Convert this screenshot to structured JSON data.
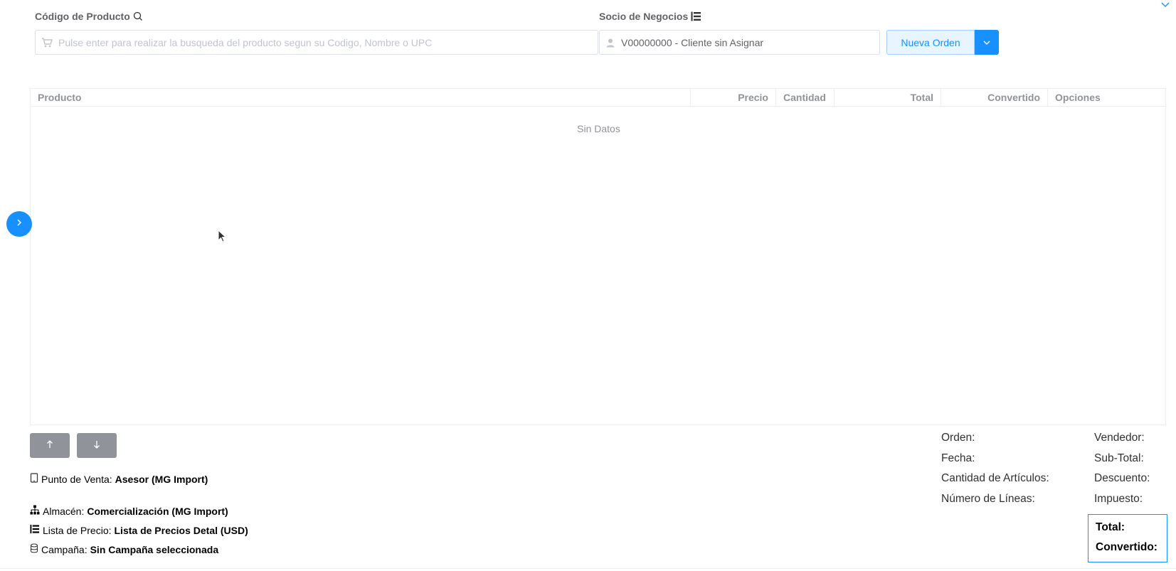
{
  "header": {
    "product_label": "Código de Producto",
    "partner_label": "Socio de Negocios",
    "product_search_placeholder": "Pulse enter para realizar la busqueda del producto segun su Codigo, Nombre o UPC",
    "partner_value": "V00000000 - Cliente sin Asignar",
    "new_order_label": "Nueva Orden"
  },
  "table": {
    "columns": {
      "producto": "Producto",
      "precio": "Precio",
      "cantidad": "Cantidad",
      "total": "Total",
      "convertido": "Convertido",
      "opciones": "Opciones"
    },
    "empty_text": "Sin Datos"
  },
  "info": {
    "pos_label": "Punto de Venta:",
    "pos_value": "Asesor (MG Import)",
    "warehouse_label": "Almacén:",
    "warehouse_value": "Comercialización (MG Import)",
    "pricelist_label": "Lista de Precio:",
    "pricelist_value": "Lista de Precios Detal (USD)",
    "campaign_label": "Campaña:",
    "campaign_value": "Sin Campaña seleccionada"
  },
  "summary": {
    "orden": "Orden:",
    "fecha": "Fecha:",
    "cantidad_articulos": "Cantidad de Artículos:",
    "numero_lineas": "Número de Líneas:",
    "vendedor": "Vendedor:",
    "subtotal": "Sub-Total:",
    "descuento": "Descuento:",
    "impuesto": "Impuesto:",
    "total": "Total:",
    "convertido": "Convertido:"
  },
  "colors": {
    "primary": "#1890ff",
    "border": "#dcdfe6",
    "muted": "#909399"
  }
}
